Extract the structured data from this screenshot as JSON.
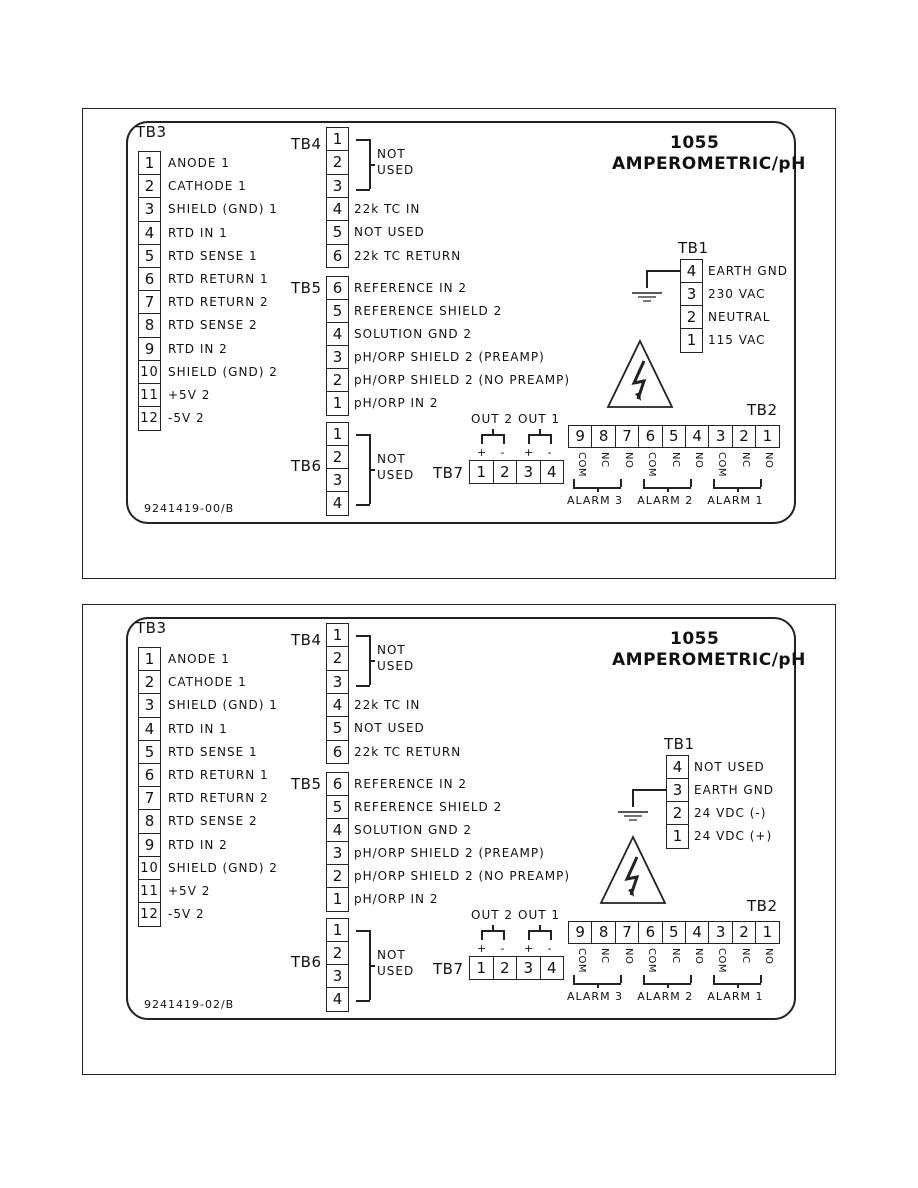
{
  "panels": [
    {
      "title": "1055",
      "subtitle": "AMPEROMETRIC/pH",
      "part_number": "9241419-00/B",
      "tb3": {
        "name": "TB3",
        "rows": [
          {
            "n": "1",
            "label": "ANODE 1"
          },
          {
            "n": "2",
            "label": "CATHODE 1"
          },
          {
            "n": "3",
            "label": "SHIELD (GND) 1"
          },
          {
            "n": "4",
            "label": "RTD IN 1"
          },
          {
            "n": "5",
            "label": "RTD SENSE 1"
          },
          {
            "n": "6",
            "label": "RTD RETURN 1"
          },
          {
            "n": "7",
            "label": "RTD RETURN 2"
          },
          {
            "n": "8",
            "label": "RTD SENSE 2"
          },
          {
            "n": "9",
            "label": "RTD IN 2"
          },
          {
            "n": "10",
            "label": "SHIELD (GND) 2"
          },
          {
            "n": "11",
            "label": "+5V 2"
          },
          {
            "n": "12",
            "label": "-5V 2"
          }
        ]
      },
      "tb4": {
        "name": "TB4",
        "not_used": [
          "NOT",
          "USED"
        ],
        "rows": [
          {
            "n": "1",
            "label": ""
          },
          {
            "n": "2",
            "label": ""
          },
          {
            "n": "3",
            "label": ""
          },
          {
            "n": "4",
            "label": "22k TC IN"
          },
          {
            "n": "5",
            "label": "NOT USED"
          },
          {
            "n": "6",
            "label": "22k TC RETURN"
          }
        ]
      },
      "tb5": {
        "name": "TB5",
        "rows": [
          {
            "n": "6",
            "label": "REFERENCE IN 2"
          },
          {
            "n": "5",
            "label": "REFERENCE SHIELD 2"
          },
          {
            "n": "4",
            "label": "SOLUTION GND 2"
          },
          {
            "n": "3",
            "label": "pH/ORP SHIELD 2 (PREAMP)"
          },
          {
            "n": "2",
            "label": "pH/ORP SHIELD 2 (NO PREAMP)"
          },
          {
            "n": "1",
            "label": "pH/ORP IN 2"
          }
        ]
      },
      "tb6": {
        "name": "TB6",
        "not_used": [
          "NOT",
          "USED"
        ],
        "rows": [
          {
            "n": "1"
          },
          {
            "n": "2"
          },
          {
            "n": "3"
          },
          {
            "n": "4"
          }
        ]
      },
      "tb1": {
        "name": "TB1",
        "ground_row": 0,
        "rows": [
          {
            "n": "4",
            "label": "EARTH GND"
          },
          {
            "n": "3",
            "label": "230 VAC"
          },
          {
            "n": "2",
            "label": "NEUTRAL"
          },
          {
            "n": "1",
            "label": "115 VAC"
          }
        ]
      },
      "tb2": {
        "name": "TB2",
        "cells": [
          "9",
          "8",
          "7",
          "6",
          "5",
          "4",
          "3",
          "2",
          "1"
        ],
        "contacts": [
          "COM",
          "NC",
          "NO",
          "COM",
          "NC",
          "NO",
          "COM",
          "NC",
          "NO"
        ],
        "alarms": [
          "ALARM 3",
          "ALARM 2",
          "ALARM 1"
        ]
      },
      "tb7": {
        "name": "TB7",
        "cells": [
          "1",
          "2",
          "3",
          "4"
        ],
        "outputs": [
          "OUT 2",
          "OUT 1"
        ],
        "polarity": [
          "+",
          "-",
          "+",
          "-"
        ]
      }
    },
    {
      "title": "1055",
      "subtitle": "AMPEROMETRIC/pH",
      "part_number": "9241419-02/B",
      "tb3": {
        "name": "TB3",
        "rows": [
          {
            "n": "1",
            "label": "ANODE 1"
          },
          {
            "n": "2",
            "label": "CATHODE 1"
          },
          {
            "n": "3",
            "label": "SHIELD (GND) 1"
          },
          {
            "n": "4",
            "label": "RTD IN 1"
          },
          {
            "n": "5",
            "label": "RTD SENSE 1"
          },
          {
            "n": "6",
            "label": "RTD RETURN 1"
          },
          {
            "n": "7",
            "label": "RTD RETURN 2"
          },
          {
            "n": "8",
            "label": "RTD SENSE 2"
          },
          {
            "n": "9",
            "label": "RTD IN 2"
          },
          {
            "n": "10",
            "label": "SHIELD (GND) 2"
          },
          {
            "n": "11",
            "label": "+5V 2"
          },
          {
            "n": "12",
            "label": "-5V 2"
          }
        ]
      },
      "tb4": {
        "name": "TB4",
        "not_used": [
          "NOT",
          "USED"
        ],
        "rows": [
          {
            "n": "1",
            "label": ""
          },
          {
            "n": "2",
            "label": ""
          },
          {
            "n": "3",
            "label": ""
          },
          {
            "n": "4",
            "label": "22k TC IN"
          },
          {
            "n": "5",
            "label": "NOT USED"
          },
          {
            "n": "6",
            "label": "22k TC RETURN"
          }
        ]
      },
      "tb5": {
        "name": "TB5",
        "rows": [
          {
            "n": "6",
            "label": "REFERENCE IN 2"
          },
          {
            "n": "5",
            "label": "REFERENCE SHIELD 2"
          },
          {
            "n": "4",
            "label": "SOLUTION GND 2"
          },
          {
            "n": "3",
            "label": "pH/ORP SHIELD 2 (PREAMP)"
          },
          {
            "n": "2",
            "label": "pH/ORP SHIELD 2 (NO PREAMP)"
          },
          {
            "n": "1",
            "label": "pH/ORP IN 2"
          }
        ]
      },
      "tb6": {
        "name": "TB6",
        "not_used": [
          "NOT",
          "USED"
        ],
        "rows": [
          {
            "n": "1"
          },
          {
            "n": "2"
          },
          {
            "n": "3"
          },
          {
            "n": "4"
          }
        ]
      },
      "tb1": {
        "name": "TB1",
        "ground_row": 1,
        "rows": [
          {
            "n": "4",
            "label": "NOT USED"
          },
          {
            "n": "3",
            "label": "EARTH GND"
          },
          {
            "n": "2",
            "label": "24 VDC (-)"
          },
          {
            "n": "1",
            "label": "24 VDC (+)"
          }
        ]
      },
      "tb2": {
        "name": "TB2",
        "cells": [
          "9",
          "8",
          "7",
          "6",
          "5",
          "4",
          "3",
          "2",
          "1"
        ],
        "contacts": [
          "COM",
          "NC",
          "NO",
          "COM",
          "NC",
          "NO",
          "COM",
          "NC",
          "NO"
        ],
        "alarms": [
          "ALARM 3",
          "ALARM 2",
          "ALARM 1"
        ]
      },
      "tb7": {
        "name": "TB7",
        "cells": [
          "1",
          "2",
          "3",
          "4"
        ],
        "outputs": [
          "OUT 2",
          "OUT 1"
        ],
        "polarity": [
          "+",
          "-",
          "+",
          "-"
        ]
      }
    }
  ]
}
